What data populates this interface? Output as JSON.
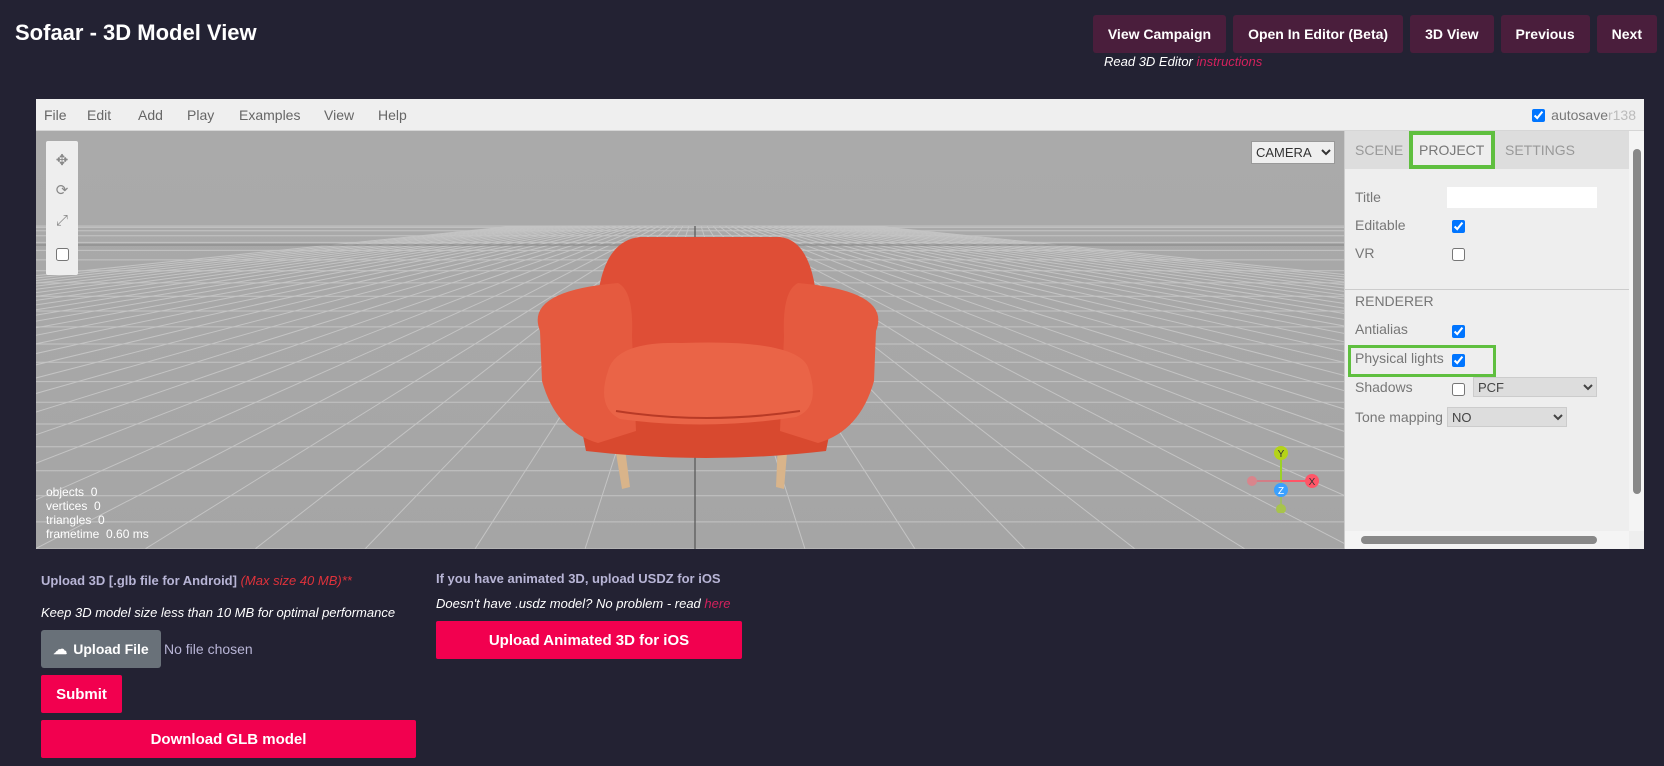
{
  "page": {
    "title": "Sofaar - 3D Model View"
  },
  "top_nav": {
    "buttons": [
      "View Campaign",
      "Open In Editor (Beta)",
      "3D View",
      "Previous",
      "Next"
    ],
    "note": "Read 3D Editor",
    "note_link": "instructions"
  },
  "editor": {
    "menu": [
      "File",
      "Edit",
      "Add",
      "Play",
      "Examples",
      "View",
      "Help"
    ],
    "autosave_label": "autosave",
    "autosave_checked": true,
    "revision": "r138",
    "camera_select": "CAMERA",
    "toolbar_icons": [
      "translate-icon",
      "rotate-icon",
      "scale-icon",
      "local-checkbox"
    ],
    "info": {
      "objects_label": "objects",
      "objects": "0",
      "vertices_label": "vertices",
      "vertices": "0",
      "triangles_label": "triangles",
      "triangles": "0",
      "frametime_label": "frametime",
      "frametime": "0.60 ms"
    },
    "gizmo": {
      "y": "Y",
      "z": "Z",
      "x": "X"
    },
    "colors": {
      "sofa": "#e8533b",
      "highlight": "#5fbf3f"
    }
  },
  "sidebar": {
    "tabs": [
      "SCENE",
      "PROJECT",
      "SETTINGS"
    ],
    "active_tab": "PROJECT",
    "title_label": "Title",
    "title_value": "",
    "editable_label": "Editable",
    "editable": true,
    "vr_label": "VR",
    "vr": false,
    "renderer_heading": "RENDERER",
    "antialias_label": "Antialias",
    "antialias": true,
    "physical_lights_label": "Physical lights",
    "physical_lights": true,
    "shadows_label": "Shadows",
    "shadows": false,
    "shadow_type": "PCF",
    "tone_mapping_label": "Tone mapping",
    "tone_mapping": "NO"
  },
  "upload": {
    "android_label": "Upload 3D [.glb file for Android]",
    "max_size": "(Max size 40 MB)**",
    "size_note": "Keep 3D model size less than 10 MB for optimal performance",
    "upload_button": "Upload File",
    "no_file": "No file chosen",
    "submit": "Submit",
    "download": "Download GLB model",
    "ios_label": "If you have animated 3D, upload USDZ for iOS",
    "usdz_note": "Doesn't have .usdz model? No problem - read",
    "usdz_link": "here",
    "ios_button": "Upload Animated 3D for iOS"
  }
}
